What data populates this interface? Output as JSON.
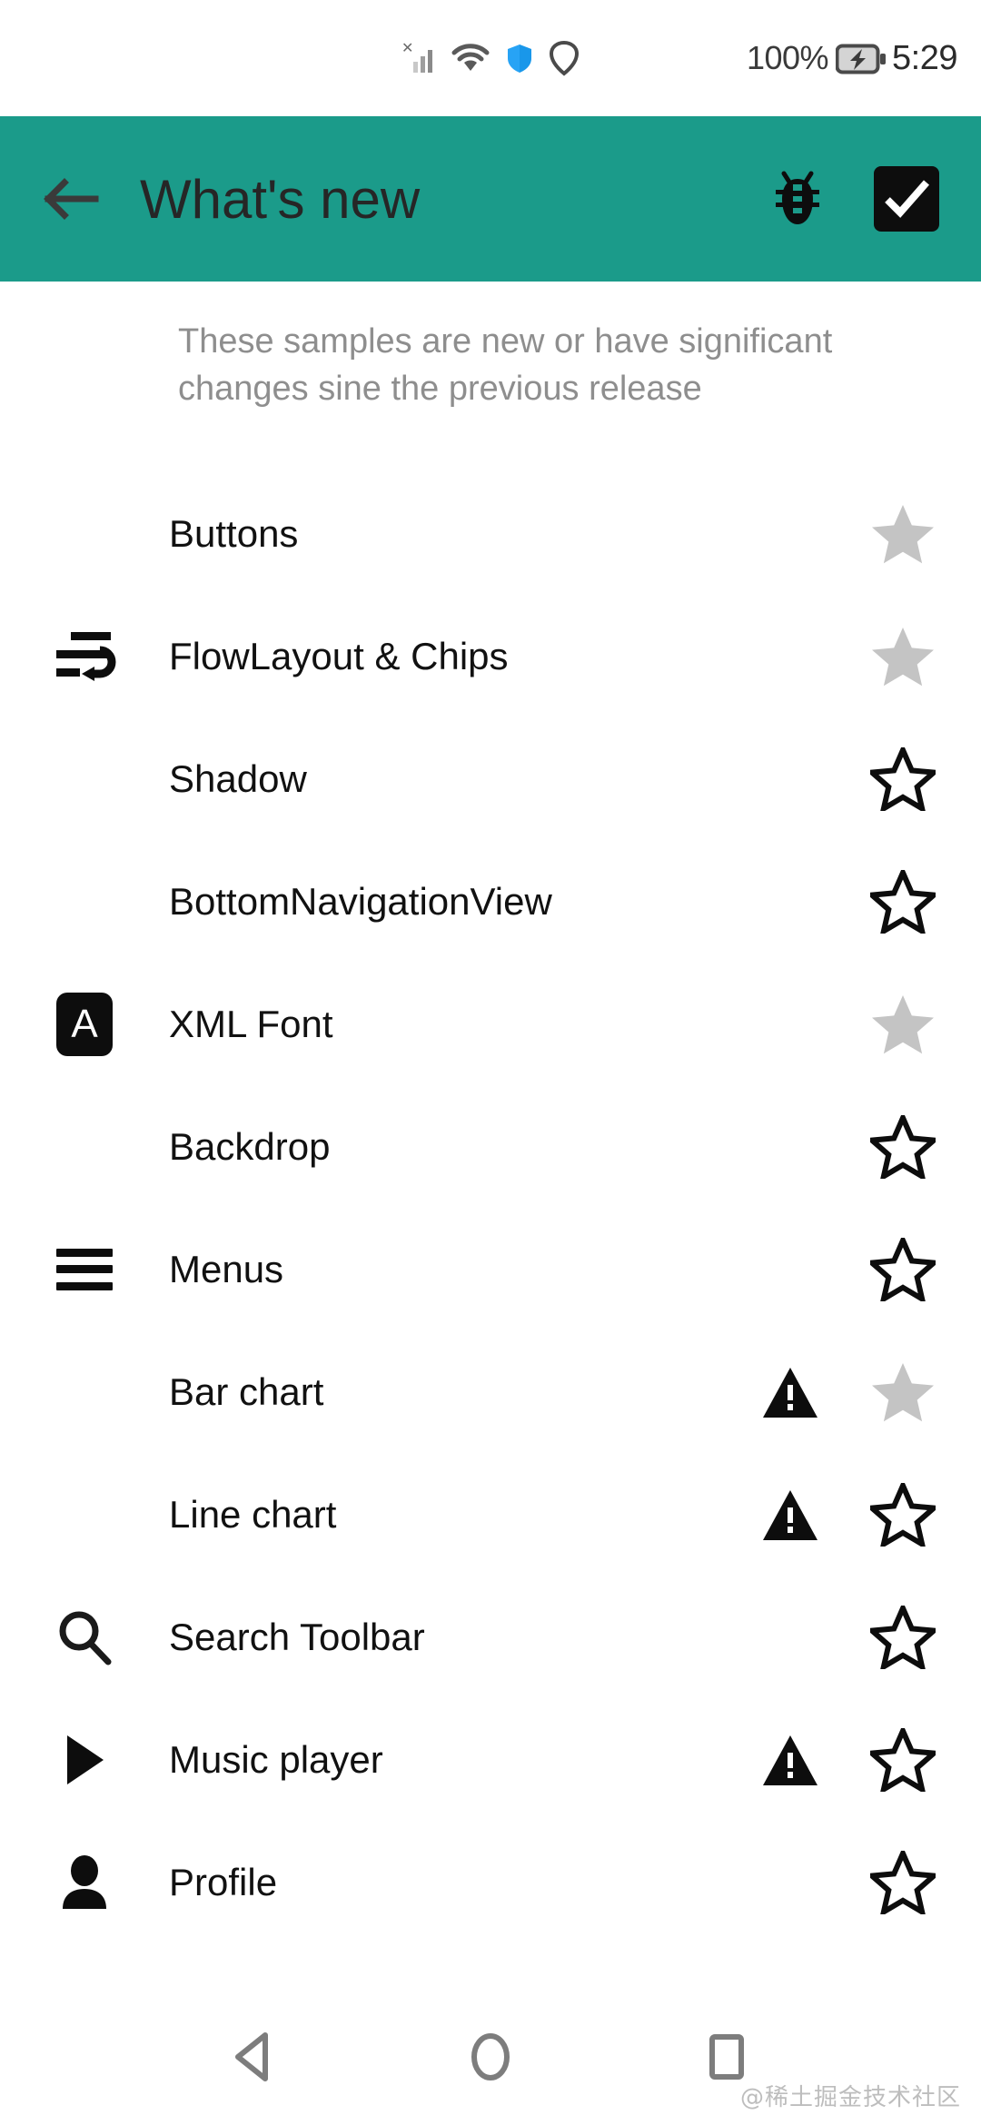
{
  "status_bar": {
    "signal_icon": "signal-bars-no-service-icon",
    "wifi_icon": "wifi-icon",
    "shield_icon": "security-shield-icon",
    "vpn_icon": "vpn-heart-icon",
    "battery_percent": "100%",
    "battery_icon": "battery-charging-icon",
    "time": "5:29"
  },
  "appbar": {
    "back_icon": "back-arrow-icon",
    "title": "What's new",
    "bug_icon": "bug-icon",
    "checkbox_icon": "checkbox-checked-icon",
    "background_color": "#1b9b8a",
    "title_color": "#262626"
  },
  "description": "These samples are new or have significant changes sine the previous release",
  "list": {
    "items": [
      {
        "label": "Buttons",
        "lead_icon": "",
        "warning": false,
        "star": "filled",
        "star_color": "#c4c4c4"
      },
      {
        "label": "FlowLayout & Chips",
        "lead_icon": "text-wrap-icon",
        "warning": false,
        "star": "filled",
        "star_color": "#c4c4c4"
      },
      {
        "label": "Shadow",
        "lead_icon": "",
        "warning": false,
        "star": "outlined",
        "star_color": "#0d0d0d"
      },
      {
        "label": "BottomNavigationView",
        "lead_icon": "",
        "warning": false,
        "star": "outlined",
        "star_color": "#0d0d0d"
      },
      {
        "label": "XML Font",
        "lead_icon": "font-a-badge-icon",
        "warning": false,
        "star": "filled",
        "star_color": "#c4c4c4"
      },
      {
        "label": "Backdrop",
        "lead_icon": "",
        "warning": false,
        "star": "outlined",
        "star_color": "#0d0d0d"
      },
      {
        "label": "Menus",
        "lead_icon": "hamburger-menu-icon",
        "warning": false,
        "star": "outlined",
        "star_color": "#0d0d0d"
      },
      {
        "label": "Bar chart",
        "lead_icon": "",
        "warning": true,
        "star": "filled",
        "star_color": "#c4c4c4"
      },
      {
        "label": "Line chart",
        "lead_icon": "",
        "warning": true,
        "star": "outlined",
        "star_color": "#0d0d0d"
      },
      {
        "label": "Search Toolbar",
        "lead_icon": "search-icon",
        "warning": false,
        "star": "outlined",
        "star_color": "#0d0d0d"
      },
      {
        "label": "Music player",
        "lead_icon": "play-arrow-icon",
        "warning": true,
        "star": "outlined",
        "star_color": "#0d0d0d"
      },
      {
        "label": "Profile",
        "lead_icon": "person-icon",
        "warning": false,
        "star": "outlined",
        "star_color": "#0d0d0d"
      }
    ],
    "warning_icon": "warning-triangle-icon",
    "label_color": "#111111"
  },
  "navbar": {
    "back_icon": "nav-back-triangle-icon",
    "home_icon": "nav-home-circle-icon",
    "recents_icon": "nav-recents-square-icon",
    "icon_color": "#7d7d7d"
  },
  "watermark": "@稀土掘金技术社区"
}
